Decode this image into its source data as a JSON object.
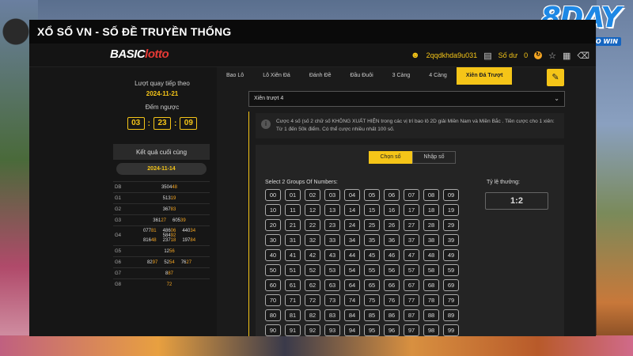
{
  "window": {
    "title": "XỔ SỐ VN - SỐ ĐỀ TRUYỀN THỐNG"
  },
  "brand": {
    "logo_text": "8DAY",
    "tagline": "START A DAY TO WIN"
  },
  "site": {
    "logo_basic": "BASIC",
    "logo_lotto": "lotto"
  },
  "header": {
    "username": "2qqdkhda9u031",
    "balance_label": "Số dư",
    "balance_value": "0",
    "colors": {
      "accent": "#f5c518"
    }
  },
  "tabs": [
    {
      "label": "Bao Lô"
    },
    {
      "label": "Lô Xiên Đá"
    },
    {
      "label": "Đánh Đề"
    },
    {
      "label": "Đầu Đuôi"
    },
    {
      "label": "3 Càng"
    },
    {
      "label": "4 Càng"
    },
    {
      "label": "Xiên Đá Trượt"
    }
  ],
  "sidebar": {
    "next_label": "Lượt quay tiếp theo",
    "next_date": "2024-11-21",
    "countdown_label": "Đếm ngược",
    "countdown": {
      "h": "03",
      "m": "23",
      "s": "09"
    },
    "last_result_label": "Kết quả cuối cùng",
    "last_result_date": "2024-11-14",
    "results": [
      {
        "label": "DB",
        "numbers": [
          [
            "3504",
            "48"
          ]
        ]
      },
      {
        "label": "G1",
        "numbers": [
          [
            "513",
            "19"
          ]
        ]
      },
      {
        "label": "G2",
        "numbers": [
          [
            "367",
            "83"
          ]
        ]
      },
      {
        "label": "G3",
        "numbers": [
          [
            "361",
            "27"
          ],
          [
            "605",
            "39"
          ]
        ]
      },
      {
        "label": "G4",
        "numbers": [
          [
            "077",
            "81"
          ],
          [
            "486",
            "06"
          ],
          [
            "440",
            "34"
          ],
          [
            "584",
            "92"
          ],
          [
            "816",
            "48"
          ],
          [
            "237",
            "18"
          ],
          [
            "197",
            "84"
          ]
        ]
      },
      {
        "label": "G5",
        "numbers": [
          [
            "12",
            "56"
          ]
        ]
      },
      {
        "label": "G6",
        "numbers": [
          [
            "82",
            "97"
          ],
          [
            "52",
            "54"
          ],
          [
            "76",
            "27"
          ]
        ]
      },
      {
        "label": "G7",
        "numbers": [
          [
            "8",
            "87"
          ]
        ]
      },
      {
        "label": "G8",
        "numbers": [
          [
            "",
            "72"
          ]
        ]
      }
    ]
  },
  "bet_select": {
    "value": "Xiên trượt 4"
  },
  "note": "Cược 4 số (số 2 chữ số KHÔNG XUẤT HIỆN trong các vị trí bao lô 2D giải Miền Nam và Miền Bắc . Tiền cược cho 1 xiên: Từ 1 đến 50k điểm. Có thể cược nhiều nhất 100 số.",
  "mode_switch": {
    "choose": "Chọn số",
    "input": "Nhập số"
  },
  "grid_label": "Select 2 Groups Of Numbers:",
  "ratio": {
    "label": "Tỷ lệ thưởng:",
    "value": "1:2"
  }
}
